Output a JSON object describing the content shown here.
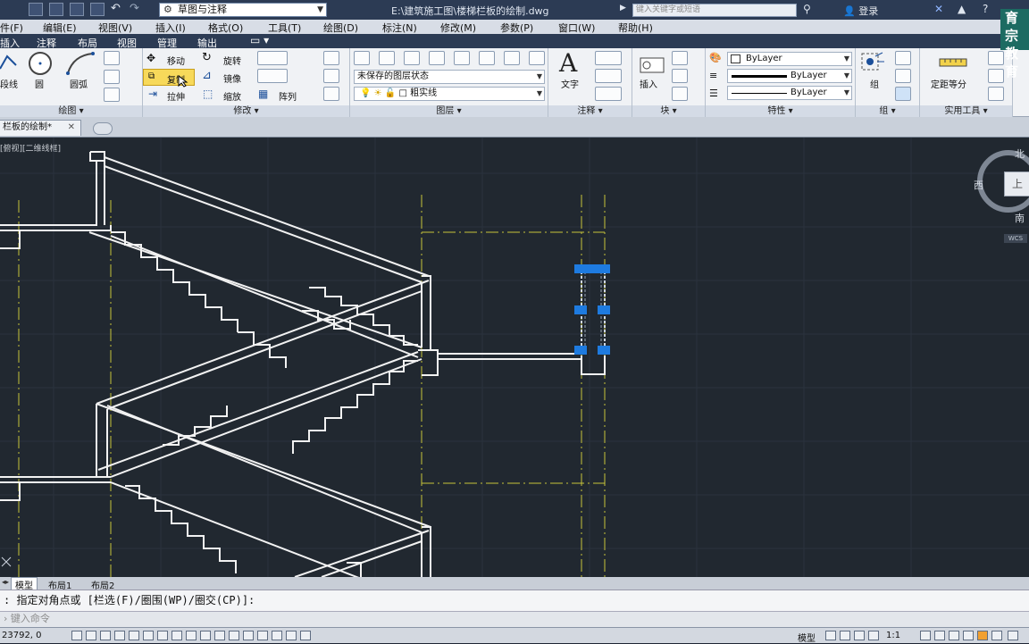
{
  "title": {
    "workspace": "草图与注释",
    "doc_path": "E:\\建筑施工图\\楼梯栏板的绘制.dwg",
    "search_placeholder": "键入关键字或短语",
    "login": "登录"
  },
  "brand": {
    "line1": "育宗",
    "line2": "教育"
  },
  "menu": [
    "件(F)",
    "编辑(E)",
    "视图(V)",
    "插入(I)",
    "格式(O)",
    "工具(T)",
    "绘图(D)",
    "标注(N)",
    "修改(M)",
    "参数(P)",
    "窗口(W)",
    "帮助(H)"
  ],
  "ribbon_tabs": [
    "插入",
    "注释",
    "布局",
    "视图",
    "管理",
    "输出"
  ],
  "draw_panel": {
    "polyline": "段线",
    "circle": "圆",
    "arc": "圆弧",
    "label": "绘图"
  },
  "modify_panel": {
    "move": "移动",
    "rotate": "旋转",
    "copy": "复制",
    "mirror": "镜像",
    "stretch": "拉伸",
    "scale": "缩放",
    "array": "阵列",
    "label": "修改"
  },
  "layer_panel": {
    "state": "未保存的图层状态",
    "current_layer": "粗实线",
    "label": "图层"
  },
  "annotation_panel": {
    "text": "文字",
    "label": "注释"
  },
  "block_panel": {
    "insert": "插入",
    "label": "块"
  },
  "properties_panel": {
    "color": "ByLayer",
    "linetype": "ByLayer",
    "lineweight": "ByLayer",
    "label": "特性"
  },
  "group_panel": {
    "group": "组",
    "label": "组"
  },
  "utilities_panel": {
    "measure": "定距等分",
    "label": "实用工具"
  },
  "doc_tab": "栏板的绘制*",
  "viewport_label": "[俯视][二维线框]",
  "viewcube": {
    "north": "北",
    "west": "西",
    "south": "南",
    "top": "上",
    "wcs": "WCS"
  },
  "layout_tabs": [
    "模型",
    "布局1",
    "布局2"
  ],
  "command_history": ": 指定对角点或 [栏选(F)/圈围(WP)/圈交(CP)]:",
  "command_placeholder": "键入命令",
  "status": {
    "coords": "23792, 0",
    "model": "模型",
    "scale": "1:1"
  },
  "colors": {
    "canvas": "#212830",
    "drawing": "#ffffff",
    "centerline": "#c8c43a",
    "grip": "#1e7be0"
  }
}
